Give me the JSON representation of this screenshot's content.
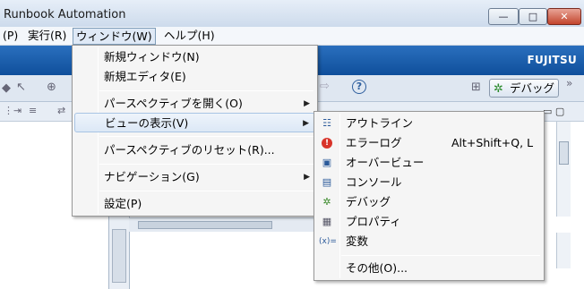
{
  "window": {
    "title": "Runbook Automation",
    "minimize": "—",
    "maximize": "□",
    "close": "✕"
  },
  "menubar": {
    "items": [
      {
        "label": "(P)"
      },
      {
        "label": "実行(R)"
      },
      {
        "label": "ウィンドウ(W)"
      },
      {
        "label": "ヘルプ(H)"
      }
    ]
  },
  "brand": {
    "logo_text": "FUJITSU"
  },
  "toolbar": {
    "perspective_label": "デバッグ",
    "help_icon": "?"
  },
  "window_menu": {
    "items": [
      {
        "label": "新規ウィンドウ(N)"
      },
      {
        "label": "新規エディタ(E)"
      },
      {
        "label": "パースペクティブを開く(O)"
      },
      {
        "label": "ビューの表示(V)"
      },
      {
        "label": "パースペクティブのリセット(R)..."
      },
      {
        "label": "ナビゲーション(G)"
      },
      {
        "label": "設定(P)"
      }
    ]
  },
  "show_view_menu": {
    "items": [
      {
        "label": "アウトライン",
        "icon": "outline-icon"
      },
      {
        "label": "エラーログ",
        "shortcut": "Alt+Shift+Q, L",
        "icon": "error-log-icon"
      },
      {
        "label": "オーバービュー",
        "icon": "overview-icon"
      },
      {
        "label": "コンソール",
        "icon": "console-icon"
      },
      {
        "label": "デバッグ",
        "icon": "debug-icon"
      },
      {
        "label": "プロパティ",
        "icon": "properties-icon"
      },
      {
        "label": "変数",
        "icon": "variables-icon"
      },
      {
        "label": "その他(O)..."
      }
    ]
  },
  "colors": {
    "brand_band": "#1a5fae",
    "menu_highlight": "#dce8f6"
  }
}
